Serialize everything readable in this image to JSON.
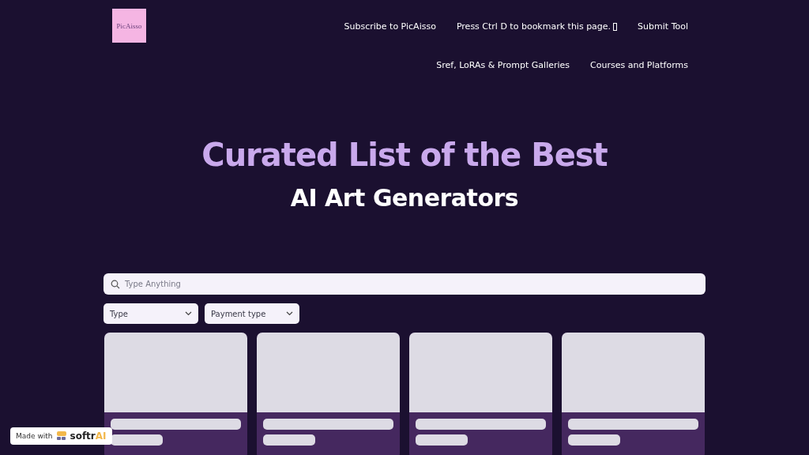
{
  "logo": {
    "text": "PicAisso"
  },
  "nav_row_1": [
    {
      "label": "Subscribe to PicAisso"
    },
    {
      "label": "Press Ctrl D to bookmark this page.",
      "icon": true
    },
    {
      "label": "Submit Tool"
    }
  ],
  "nav_row_2": [
    {
      "label": "Sref, LoRAs & Prompt Galleries"
    },
    {
      "label": "Courses and Platforms"
    }
  ],
  "hero": {
    "title": "Curated List of the Best",
    "subtitle": "AI Art Generators"
  },
  "search": {
    "placeholder": "Type Anything"
  },
  "filters": [
    {
      "label": "Type"
    },
    {
      "label": "Payment type"
    }
  ],
  "cards": [
    {
      "kind": "loading"
    },
    {
      "kind": "loading"
    },
    {
      "kind": "loading"
    },
    {
      "kind": "loading"
    }
  ],
  "badge": {
    "prefix": "Made with",
    "brand": [
      "softr",
      "AI"
    ]
  }
}
